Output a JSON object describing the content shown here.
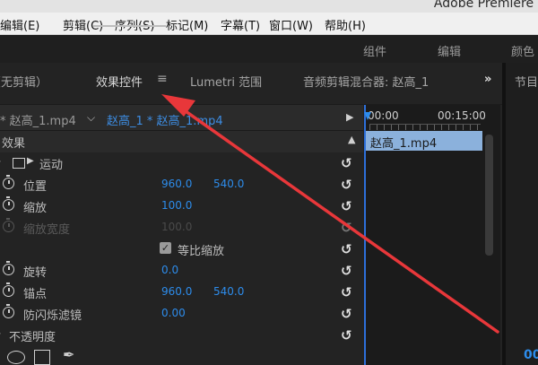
{
  "app_title": "Adobe Premiere P",
  "menu": [
    "编辑(E)",
    "剪辑(C)",
    "序列(S)",
    "标记(M)",
    "字幕(T)",
    "窗口(W)",
    "帮助(H)"
  ],
  "workspace_tabs": [
    "组件",
    "编辑",
    "颜色"
  ],
  "panel_tabs": {
    "no_clip": "（无剪辑）",
    "effect_controls": "效果控件",
    "lumetri": "Lumetri 范围",
    "audio_mixer": "音频剪辑混合器: 赵高_1",
    "more": "»",
    "menu_icon": "≡"
  },
  "program_tab": "节目",
  "program_timecode": "00",
  "clip_row": {
    "source_clip": "* 赵高_1.mp4",
    "chevron": "⌵",
    "sequence_clip": "赵高_1 * 赵高_1.mp4"
  },
  "timeline": {
    "start": "00:00",
    "end": "00:15:00",
    "clip_label": "赵高_1.mp4"
  },
  "effects_header": "效果",
  "motion": "运动",
  "properties": [
    {
      "label": "位置",
      "v1": "960.0",
      "v2": "540.0"
    },
    {
      "label": "缩放",
      "v1": "100.0"
    },
    {
      "label": "缩放宽度",
      "v1": "100.0"
    },
    {
      "label": "等比缩放"
    },
    {
      "label": "旋转",
      "v1": "0.0"
    },
    {
      "label": "锚点",
      "v1": "960.0",
      "v2": "540.0"
    },
    {
      "label": "防闪烁滤镜",
      "v1": "0.00"
    }
  ],
  "opacity": "不透明度",
  "icons": {
    "reset": "↺",
    "play_arrow": "▶",
    "collapse": "▲",
    "checkmark": "✓",
    "pen": "✒"
  },
  "colors": {
    "accent_blue": "#2d8ceb",
    "clip_blue": "#8bb1dc",
    "arrow_red": "#e8373a"
  }
}
